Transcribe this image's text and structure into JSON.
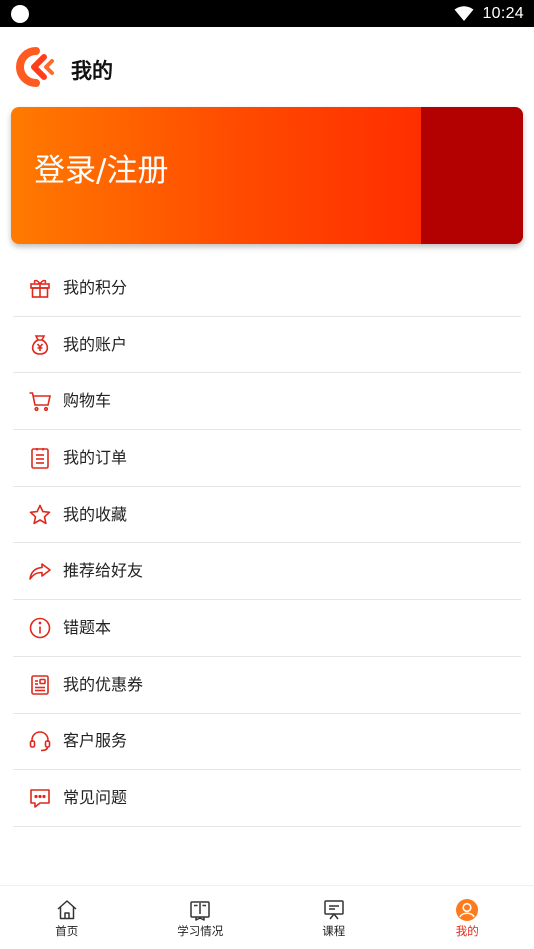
{
  "status_bar": {
    "time": "10:24"
  },
  "header": {
    "title": "我的"
  },
  "login": {
    "label": "登录/注册"
  },
  "menu": [
    {
      "label": "我的积分",
      "icon": "gift-icon"
    },
    {
      "label": "我的账户",
      "icon": "money-bag-icon"
    },
    {
      "label": "购物车",
      "icon": "cart-icon"
    },
    {
      "label": "我的订单",
      "icon": "order-list-icon"
    },
    {
      "label": "我的收藏",
      "icon": "star-icon"
    },
    {
      "label": "推荐给好友",
      "icon": "share-arrow-icon"
    },
    {
      "label": "错题本",
      "icon": "info-icon"
    },
    {
      "label": "我的优惠券",
      "icon": "coupon-icon"
    },
    {
      "label": "客户服务",
      "icon": "headset-icon"
    },
    {
      "label": "常见问题",
      "icon": "chat-bubble-icon"
    }
  ],
  "bottom_nav": [
    {
      "label": "首页",
      "icon": "home-icon"
    },
    {
      "label": "学习情况",
      "icon": "book-icon"
    },
    {
      "label": "课程",
      "icon": "course-board-icon"
    },
    {
      "label": "我的",
      "icon": "user-profile-icon",
      "active": true
    }
  ],
  "colors": {
    "accent": "#e0281c",
    "banner_start": "#ff7a00",
    "banner_end": "#ff1e00",
    "banner_strip": "#b30000"
  }
}
